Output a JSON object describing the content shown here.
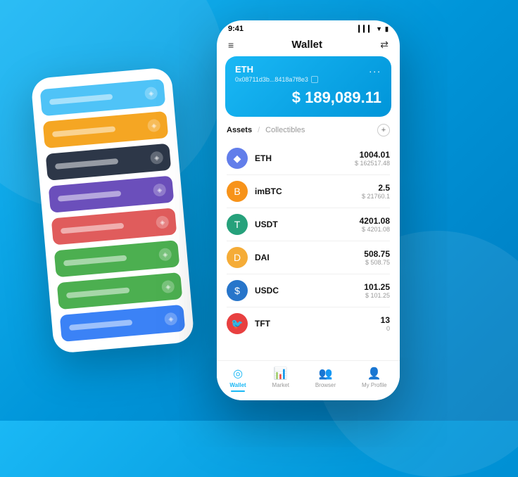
{
  "background": {
    "color_start": "#1ab8f5",
    "color_end": "#007bbf"
  },
  "back_phone": {
    "rows": [
      {
        "color": "#4fc3f7",
        "label": "row-1"
      },
      {
        "color": "#f5a623",
        "label": "row-2"
      },
      {
        "color": "#2d3748",
        "label": "row-3"
      },
      {
        "color": "#6b4fbb",
        "label": "row-4"
      },
      {
        "color": "#e05c5c",
        "label": "row-5"
      },
      {
        "color": "#4caf50",
        "label": "row-6"
      },
      {
        "color": "#4caf50",
        "label": "row-7"
      },
      {
        "color": "#3b82f6",
        "label": "row-8"
      }
    ]
  },
  "status_bar": {
    "time": "9:41",
    "signal": "▎▎▎",
    "wifi": "wifi",
    "battery": "🔋"
  },
  "header": {
    "menu_icon": "≡",
    "title": "Wallet",
    "swap_icon": "⇄"
  },
  "eth_card": {
    "currency_label": "ETH",
    "address": "0x08711d3b...8418a7f8e3",
    "amount": "$ 189,089.11",
    "dollar_sign": "$",
    "more_icon": "..."
  },
  "assets": {
    "tab_active": "Assets",
    "tab_separator": "/",
    "tab_inactive": "Collectibles",
    "add_icon": "+"
  },
  "tokens": [
    {
      "name": "ETH",
      "icon_char": "◆",
      "icon_class": "icon-eth",
      "amount": "1004.01",
      "usd": "$ 162517.48"
    },
    {
      "name": "imBTC",
      "icon_char": "B",
      "icon_class": "icon-imbtc",
      "amount": "2.5",
      "usd": "$ 21760.1"
    },
    {
      "name": "USDT",
      "icon_char": "T",
      "icon_class": "icon-usdt",
      "amount": "4201.08",
      "usd": "$ 4201.08"
    },
    {
      "name": "DAI",
      "icon_char": "D",
      "icon_class": "icon-dai",
      "amount": "508.75",
      "usd": "$ 508.75"
    },
    {
      "name": "USDC",
      "icon_char": "$",
      "icon_class": "icon-usdc",
      "amount": "101.25",
      "usd": "$ 101.25"
    },
    {
      "name": "TFT",
      "icon_char": "🐦",
      "icon_class": "icon-tft",
      "amount": "13",
      "usd": "0"
    }
  ],
  "bottom_nav": [
    {
      "id": "wallet",
      "icon": "◎",
      "label": "Wallet",
      "active": true
    },
    {
      "id": "market",
      "icon": "📊",
      "label": "Market",
      "active": false
    },
    {
      "id": "browser",
      "icon": "👥",
      "label": "Browser",
      "active": false
    },
    {
      "id": "profile",
      "icon": "👤",
      "label": "My Profile",
      "active": false
    }
  ]
}
